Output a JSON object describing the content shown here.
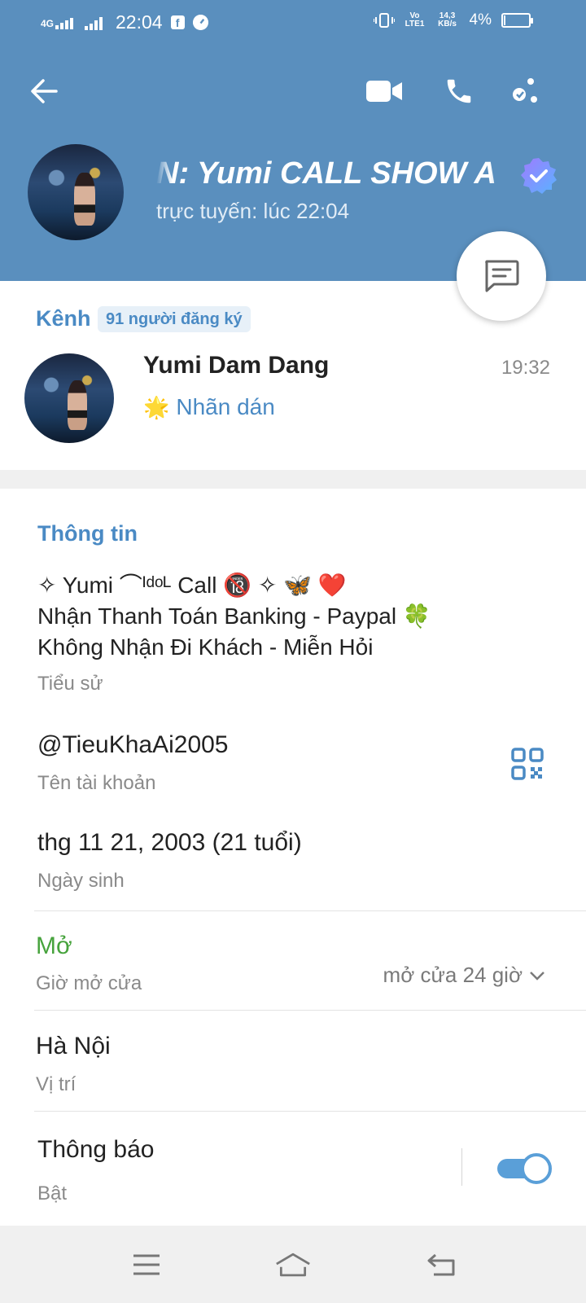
{
  "status_bar": {
    "network": "4G",
    "time": "22:04",
    "facebook": "f",
    "volte": "Vo LTE1",
    "speed": "14,3 KB/s",
    "battery_percent": "4%",
    "battery_level": 0.04
  },
  "header": {
    "title": "N: Yumi CALL SHOW   A",
    "status": "trực tuyến: lúc 22:04",
    "background_color": "#5a8fbe",
    "icons": [
      "back-arrow-icon",
      "video-call-icon",
      "phone-icon",
      "more-icon"
    ]
  },
  "channel": {
    "label": "Kênh",
    "subscribers": "91 người đăng ký",
    "name": "Yumi Dam Dang",
    "time": "19:32",
    "preview_emoji": "🌟",
    "preview_text": "Nhãn dán"
  },
  "info": {
    "title": "Thông tin",
    "bio_lines": [
      "✧ Yumi ⌒ᴵᵈᵒᴸ Call 🔞 ✧ 🦋 ❤️",
      "Nhận Thanh Toán Banking - Paypal 🍀",
      "Không Nhận Đi Khách - Miễn Hỏi"
    ],
    "bio_label": "Tiểu sử",
    "username": "@TieuKhaAi2005",
    "username_label": "Tên tài khoản",
    "birthday": "thg 11 21, 2003 (21 tuổi)",
    "birthday_label": "Ngày sinh",
    "open_status": "Mở",
    "hours_label": "Giờ mở cửa",
    "hours_value": "mở cửa 24 giờ",
    "location": "Hà Nội",
    "location_label": "Vị trí",
    "notifications": "Thông báo",
    "notifications_state": "Bật",
    "notifications_on": true
  },
  "colors": {
    "accent": "#4a8ac4",
    "open_green": "#47a33d",
    "toggle": "#5a9fd8"
  }
}
